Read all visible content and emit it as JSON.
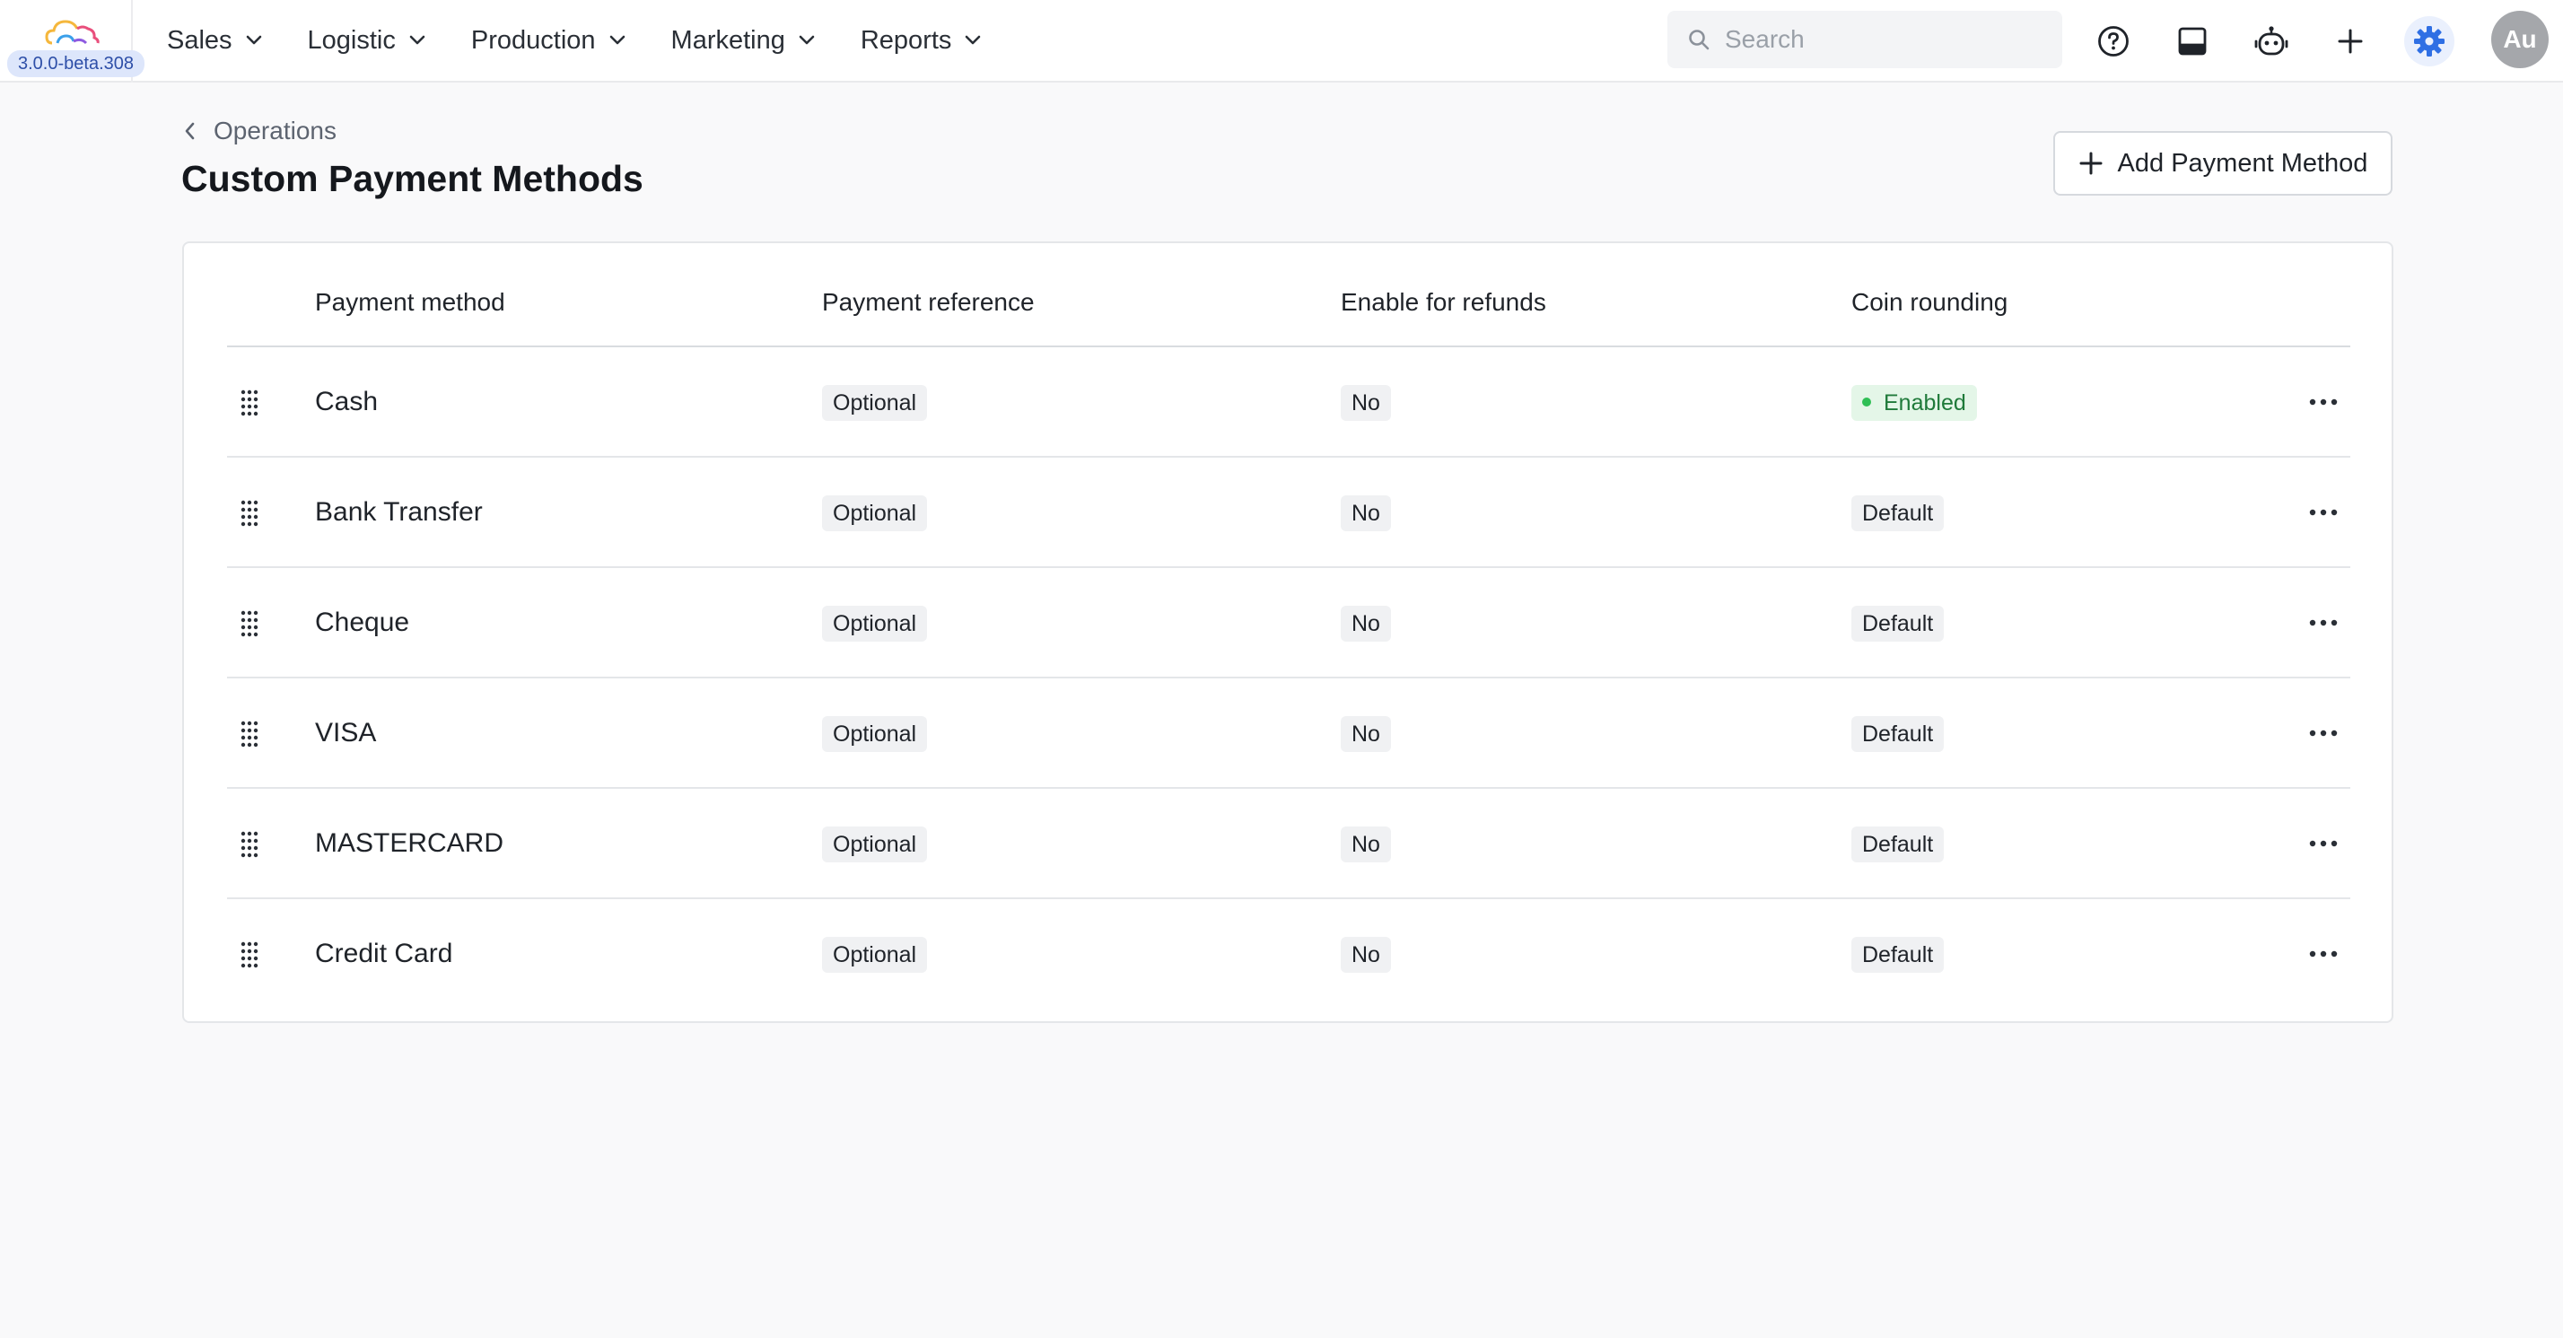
{
  "app": {
    "version": "3.0.0-beta.308",
    "colors": {
      "accent": "#2f6fe4",
      "enabled_green": "#2fbf55"
    }
  },
  "nav": {
    "items": [
      {
        "label": "Sales",
        "icon": "chevron-down-icon"
      },
      {
        "label": "Logistic",
        "icon": "chevron-down-icon"
      },
      {
        "label": "Production",
        "icon": "chevron-down-icon"
      },
      {
        "label": "Marketing",
        "icon": "chevron-down-icon"
      },
      {
        "label": "Reports",
        "icon": "chevron-down-icon"
      }
    ],
    "search": {
      "placeholder": "Search",
      "value": ""
    },
    "icons": [
      "help-icon",
      "inbox-icon",
      "bot-icon",
      "plus-icon",
      "settings-icon"
    ],
    "avatar": "Au"
  },
  "page": {
    "breadcrumb": "Operations",
    "title": "Custom Payment Methods",
    "add_button": "Add Payment Method"
  },
  "table": {
    "headers": [
      "Payment method",
      "Payment reference",
      "Enable for refunds",
      "Coin rounding"
    ],
    "rows": [
      {
        "name": "Cash",
        "reference": "Optional",
        "refunds": "No",
        "rounding": "Enabled"
      },
      {
        "name": "Bank Transfer",
        "reference": "Optional",
        "refunds": "No",
        "rounding": "Default"
      },
      {
        "name": "Cheque",
        "reference": "Optional",
        "refunds": "No",
        "rounding": "Default"
      },
      {
        "name": "VISA",
        "reference": "Optional",
        "refunds": "No",
        "rounding": "Default"
      },
      {
        "name": "MASTERCARD",
        "reference": "Optional",
        "refunds": "No",
        "rounding": "Default"
      },
      {
        "name": "Credit Card",
        "reference": "Optional",
        "refunds": "No",
        "rounding": "Default"
      }
    ]
  }
}
